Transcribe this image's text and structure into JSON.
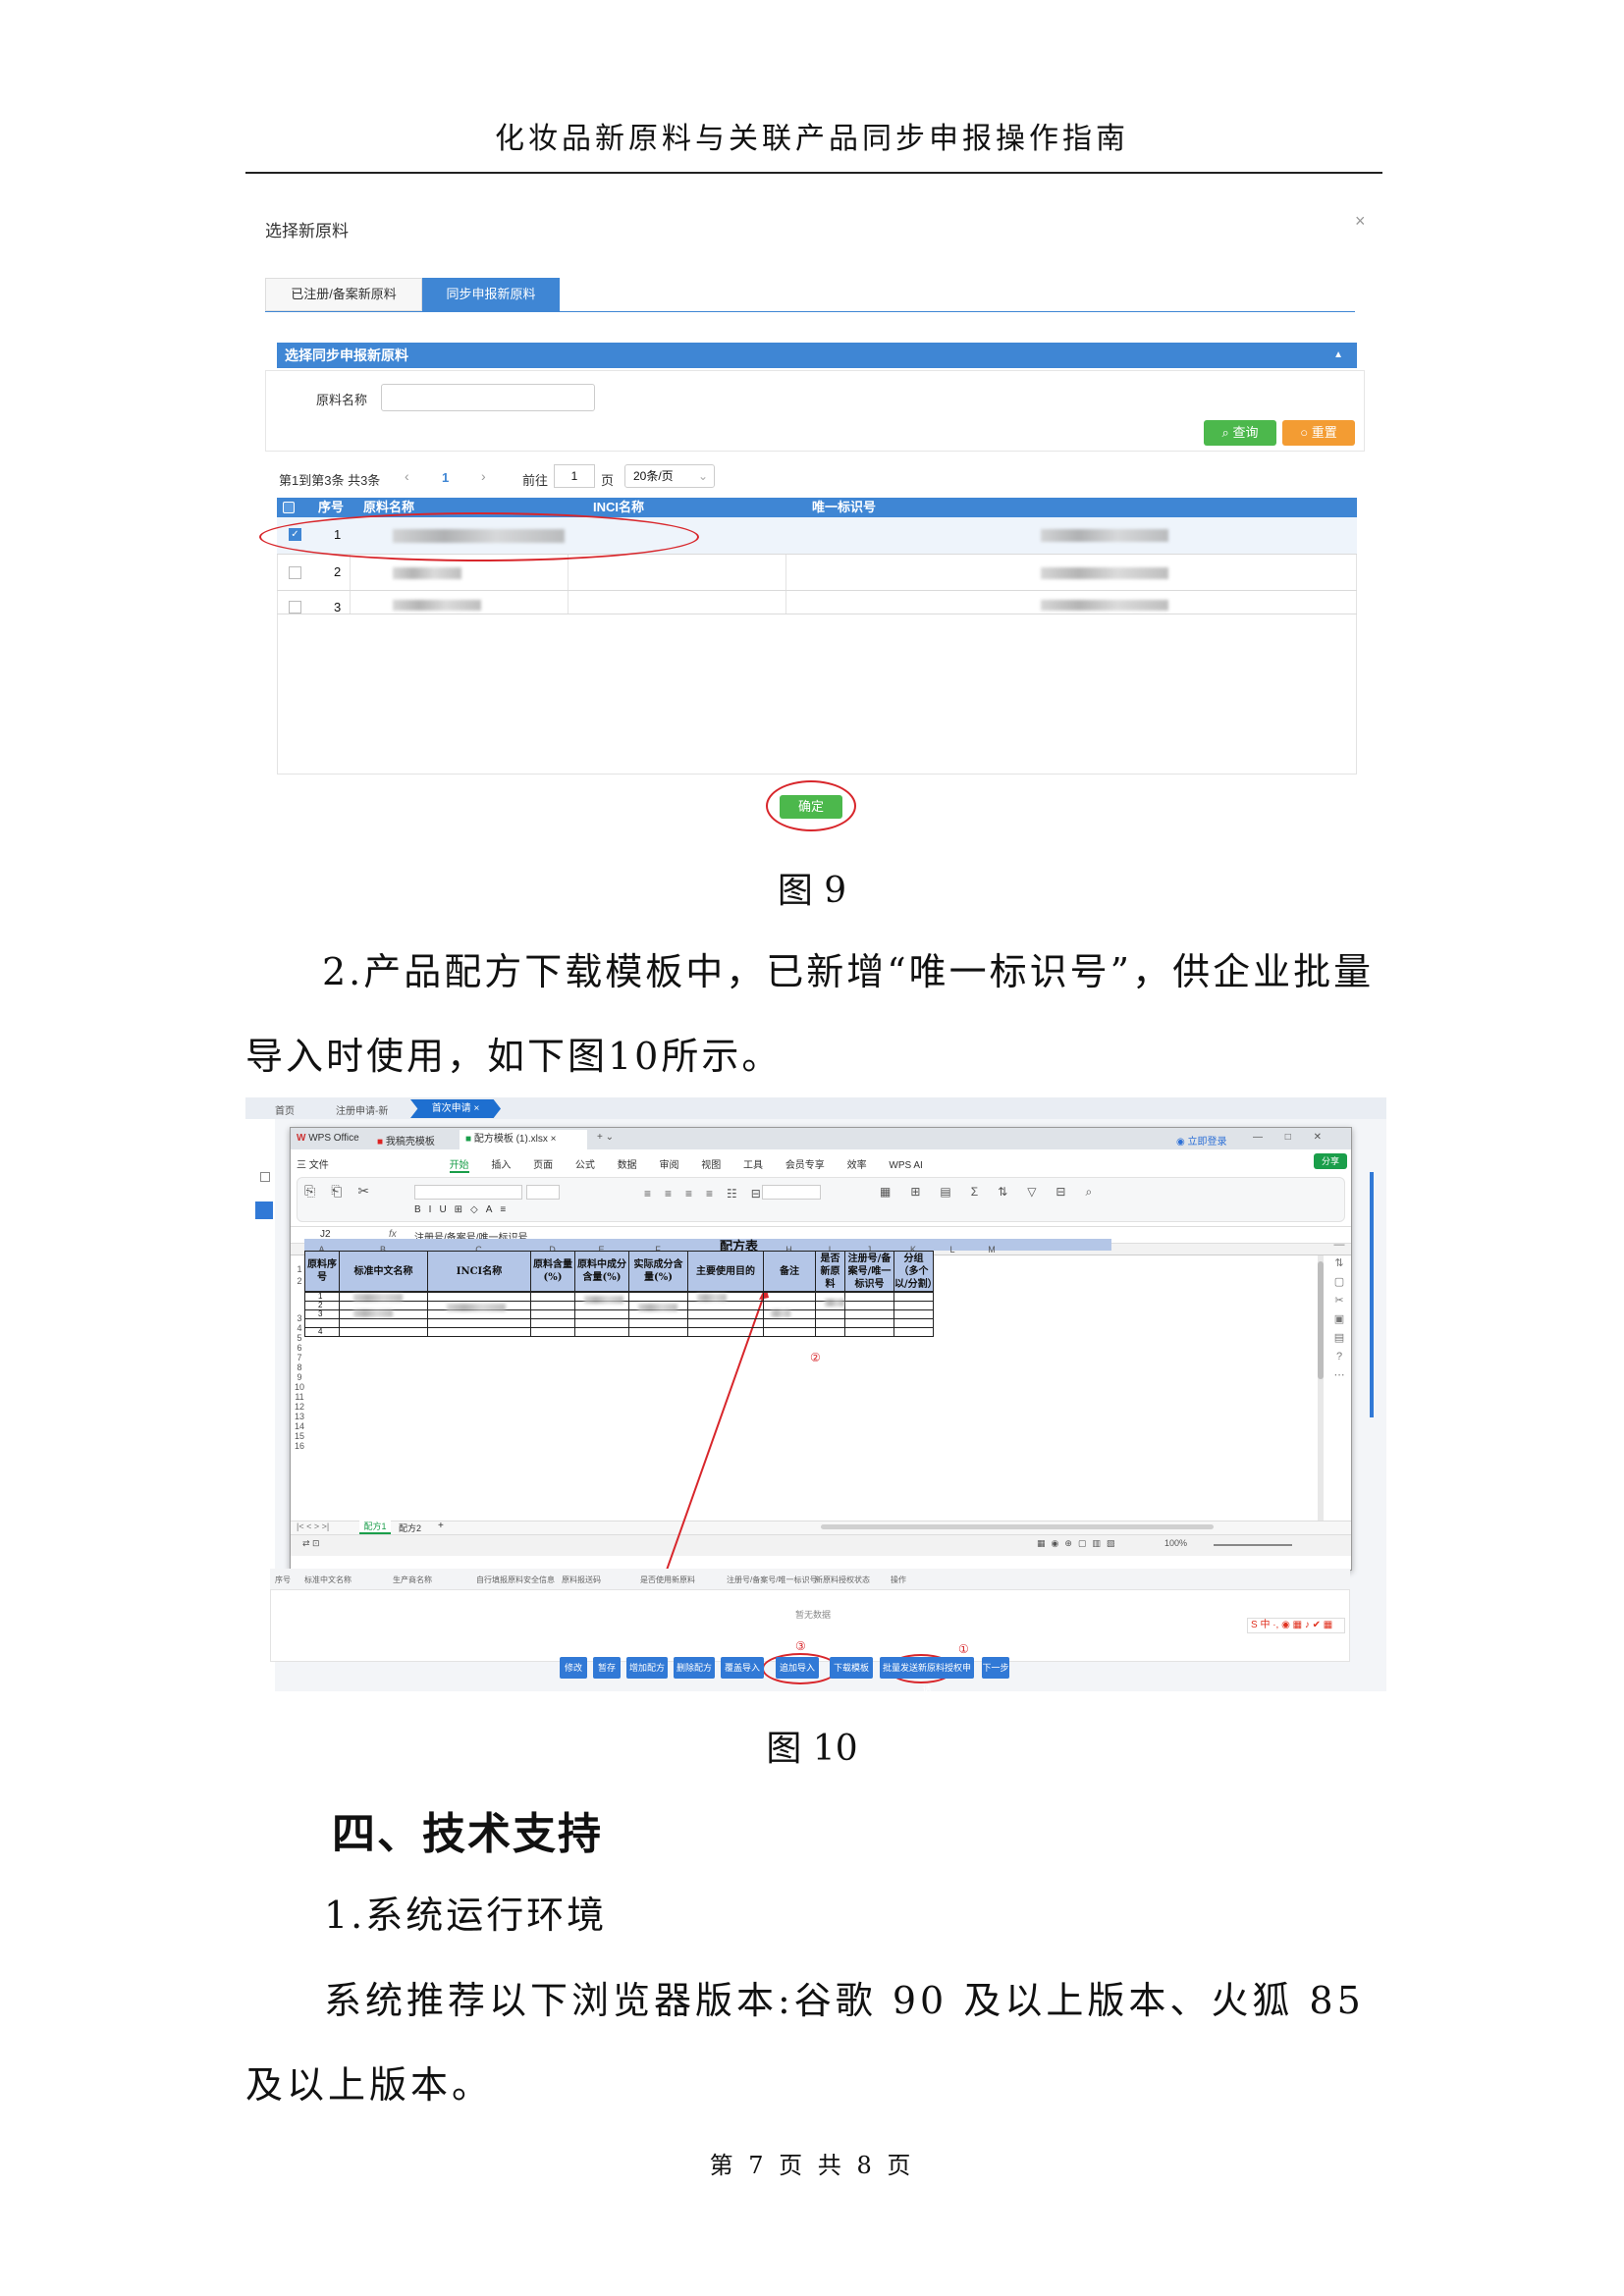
{
  "header": {
    "title": "化妆品新原料与关联产品同步申报操作指南"
  },
  "fig9": {
    "dialog_title": "选择新原料",
    "close": "×",
    "tabs": [
      "已注册/备案新原料",
      "同步申报新原料"
    ],
    "section": "选择同步申报新原料",
    "collapse": "▲",
    "field_label": "原料名称",
    "btn_query": "查询",
    "btn_reset": "重置",
    "pager": {
      "summary": "第1到第3条 共3条",
      "prev": "‹",
      "page": "1",
      "next": "›",
      "goto": "前往",
      "goto_val": "1",
      "page_unit": "页",
      "per_page": "20条/页"
    },
    "columns": [
      "序号",
      "原料名称",
      "INCI名称",
      "唯一标识号"
    ],
    "rows": [
      "1",
      "2",
      "3"
    ],
    "confirm": "确定",
    "caption": "图 9"
  },
  "para1": "2.产品配方下载模板中，已新增“唯一标识号”，供企业批量导入时使用，如下图10所示。",
  "fig10": {
    "tabs": [
      "首页",
      "注册申请-新",
      "首次申请"
    ],
    "wps_tabs": [
      "WPS Office",
      "我稿壳模板",
      "配方模板 (1).xlsx"
    ],
    "menu": [
      "三 文件",
      "开始",
      "插入",
      "页面",
      "公式",
      "数据",
      "审阅",
      "视图",
      "工具",
      "会员专享",
      "效率",
      "WPS AI"
    ],
    "login": "立即登录",
    "share": "分享",
    "cellref": "J2",
    "fx": "fx",
    "formula": "注册号/备案号/唯一标识号",
    "cols": [
      "A",
      "B",
      "C",
      "D",
      "E",
      "F",
      "G",
      "H",
      "I",
      "J",
      "K",
      "L",
      "M"
    ],
    "sheet_title": "配方表",
    "headers": [
      "原料序号",
      "标准中文名称",
      "INCI名称",
      "原料含量(%)",
      "原料中成分含量(%)",
      "实际成分含量(%)",
      "主要使用目的",
      "备注",
      "是否新原料",
      "注册号/备案号/唯一标识号",
      "分组（多个以/分割）"
    ],
    "row_nums": [
      "1",
      "2",
      "3",
      "4",
      "5",
      "6",
      "7",
      "8",
      "9",
      "10",
      "11",
      "12",
      "13",
      "14",
      "15",
      "16"
    ],
    "ids": [
      "1",
      "2",
      "3",
      "4"
    ],
    "sheets": [
      "配方1",
      "配方2",
      "+"
    ],
    "zoom": "100%",
    "list_cols": [
      "序号",
      "标准中文名称",
      "生产商名称",
      "自行填报原料安全信息",
      "原料报送码",
      "是否使用新原料",
      "注册号/备案号/唯一标识号",
      "新原料授权状态",
      "操作"
    ],
    "empty": "暂无数据",
    "buttons": [
      "修改",
      "暂存",
      "增加配方",
      "删除配方",
      "覆盖导入",
      "追加导入",
      "下载模板",
      "批量发送新原料授权申请",
      "下一步"
    ],
    "marks": [
      "①",
      "②",
      "③"
    ],
    "caption": "图 10"
  },
  "section4": "四、技术支持",
  "sub1": "1.系统运行环境",
  "para2": "系统推荐以下浏览器版本:谷歌 90 及以上版本、火狐 85 及以上版本。",
  "footer": "第 7 页 共 8 页"
}
